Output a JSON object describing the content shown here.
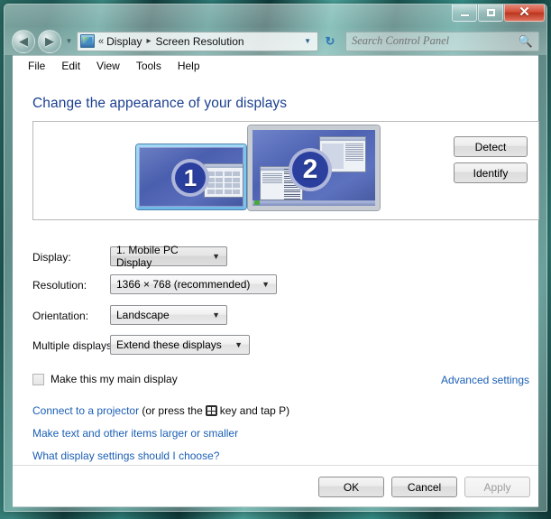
{
  "window": {
    "controls": {
      "minimize": "minimize-button",
      "maximize": "maximize-button",
      "close_label": "✕"
    }
  },
  "addressbar": {
    "double_chevron": "«",
    "crumb_1": "Display",
    "separator": "▸",
    "crumb_2": "Screen Resolution",
    "caret": "▼",
    "refresh": "↻"
  },
  "search": {
    "placeholder": "Search Control Panel",
    "icon": "search-icon"
  },
  "menubar": {
    "items": [
      {
        "label": "File"
      },
      {
        "label": "Edit"
      },
      {
        "label": "View"
      },
      {
        "label": "Tools"
      },
      {
        "label": "Help"
      }
    ]
  },
  "main": {
    "heading": "Change the appearance of your displays",
    "preview": {
      "monitor_1_number": "1",
      "monitor_2_number": "2"
    },
    "buttons": {
      "detect": "Detect",
      "identify": "Identify"
    },
    "fields": {
      "display_label": "Display:",
      "display_value": "1. Mobile PC Display",
      "resolution_label": "Resolution:",
      "resolution_value": "1366 × 768 (recommended)",
      "orientation_label": "Orientation:",
      "orientation_value": "Landscape",
      "multiple_label": "Multiple displays:",
      "multiple_value": "Extend these displays",
      "caret": "▼"
    },
    "checkbox_label": "Make this my main display",
    "advanced_settings": "Advanced settings",
    "links": {
      "projector_link": "Connect to a projector",
      "projector_pre": "(or press the",
      "projector_post": "key and tap P)",
      "text_size": "Make text and other items larger or smaller",
      "what_settings": "What display settings should I choose?"
    }
  },
  "footer": {
    "ok": "OK",
    "cancel": "Cancel",
    "apply": "Apply"
  }
}
